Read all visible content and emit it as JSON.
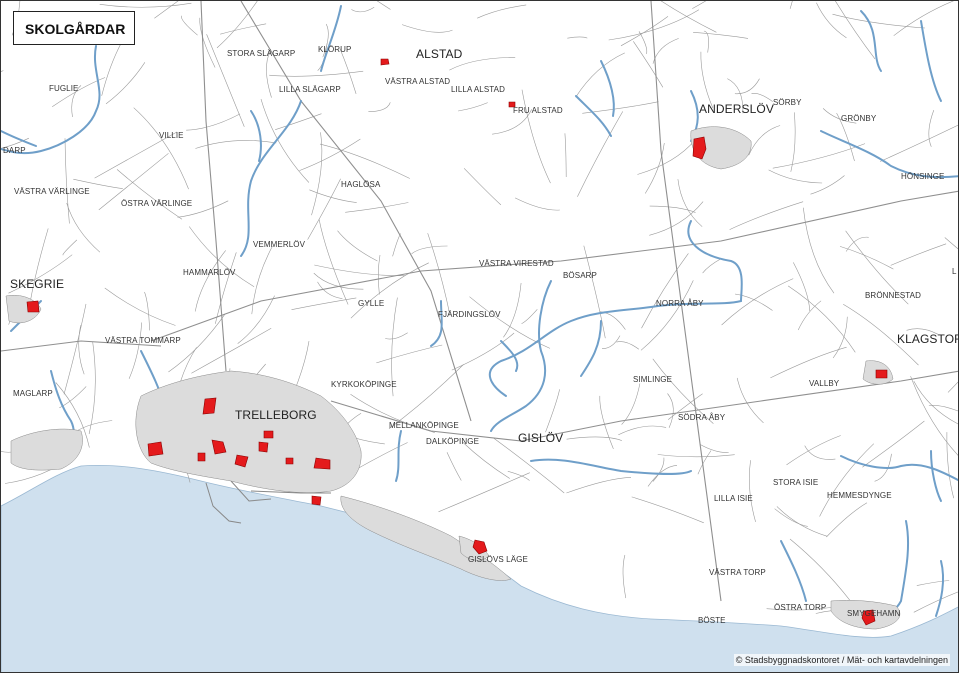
{
  "title": "SKOLGÅRDAR",
  "credit": "© Stadsbyggnadskontoret / Mät- och kartavdelningen",
  "colors": {
    "school_area": "#e41a1c",
    "sea": "#cfe0ee",
    "water_line": "#6f9fc9",
    "roads": "#9a9a9a"
  },
  "towns": [
    "TRELLEBORG",
    "ANDERSLÖV",
    "GISLÖV",
    "SKEGRIE",
    "KLAGSTORP",
    "ALSTAD"
  ],
  "places": [
    "STORA SLÄGARP",
    "KLÖRUP",
    "VÄSTRA ALSTAD",
    "LILLA SLÄGARP",
    "LILLA ALSTAD",
    "FRU ALSTAD",
    "FUGLIE",
    "VILLIE",
    "DARP",
    "VÄSTRA VÄRLINGE",
    "ÖSTRA VÄRLINGE",
    "HAGLÖSA",
    "SÖRBY",
    "GRÖNBY",
    "HÖNSINGE",
    "VEMMERLÖV",
    "HAMMARLÖV",
    "VÄSTRA VIRESTAD",
    "BÖSARP",
    "GYLLE",
    "FJÄRDINGSLÖV",
    "NORRA ÅBY",
    "BRÖNNESTAD",
    "VÄSTRA TOMMARP",
    "KYRKOKÖPINGE",
    "SIMLINGE",
    "VALLBY",
    "MAGLARP",
    "MELLANKÖPINGE",
    "DALKÖPINGE",
    "SÖDRA ÅBY",
    "STORA ISIE",
    "LILLA ISIE",
    "HEMMESDYNGE",
    "GISLÖVS LÄGE",
    "VÄSTRA TORP",
    "ÖSTRA TORP",
    "SMYGEHAMN",
    "BÖSTE",
    "L"
  ],
  "legend_item": "school-yard"
}
